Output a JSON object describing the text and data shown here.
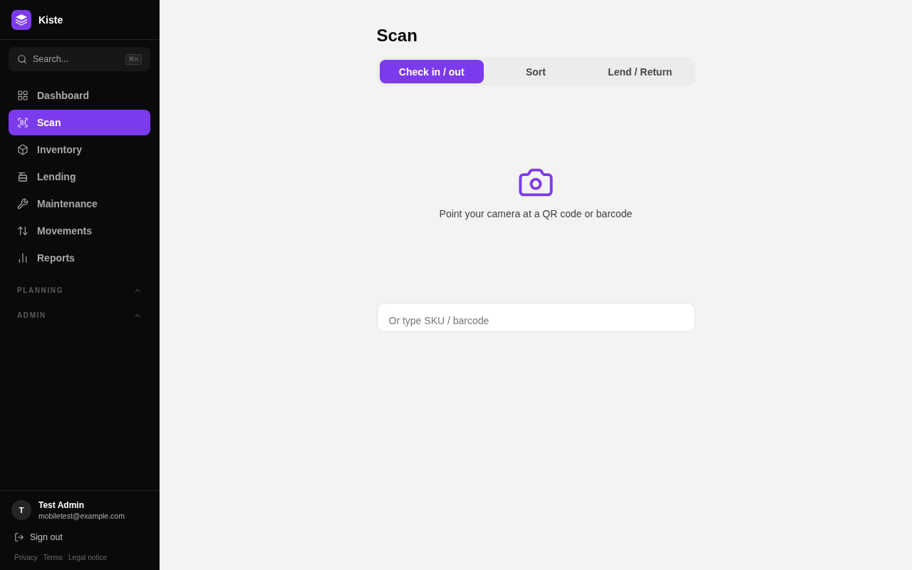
{
  "sidebar": {
    "brand": "Kiste",
    "search": {
      "placeholder": "Search...",
      "shortcut": "⌘K"
    },
    "nav_items": [
      {
        "label": "Dashboard",
        "selected": false
      },
      {
        "label": "Scan",
        "selected": true
      },
      {
        "label": "Inventory",
        "selected": false
      },
      {
        "label": "Lending",
        "selected": false
      },
      {
        "label": "Maintenance",
        "selected": false
      },
      {
        "label": "Movements",
        "selected": false
      },
      {
        "label": "Reports",
        "selected": false
      }
    ],
    "sections": [
      {
        "label": "PLANNING"
      },
      {
        "label": "ADMIN"
      }
    ],
    "user": {
      "initial": "T",
      "name": "Test Admin",
      "email": "mobiletest@example.com"
    },
    "sign_out": "Sign out",
    "footer_links": [
      "Privacy",
      "Terms",
      "Legal notice"
    ]
  },
  "main": {
    "title": "Scan",
    "tabs": [
      {
        "label": "Check in / out",
        "selected": true
      },
      {
        "label": "Sort",
        "selected": false
      },
      {
        "label": "Lend / Return",
        "selected": false
      }
    ],
    "scanner": {
      "prompt": "Point your camera at a QR code or barcode"
    },
    "manual_entry": {
      "placeholder": "Or type SKU / barcode"
    }
  }
}
